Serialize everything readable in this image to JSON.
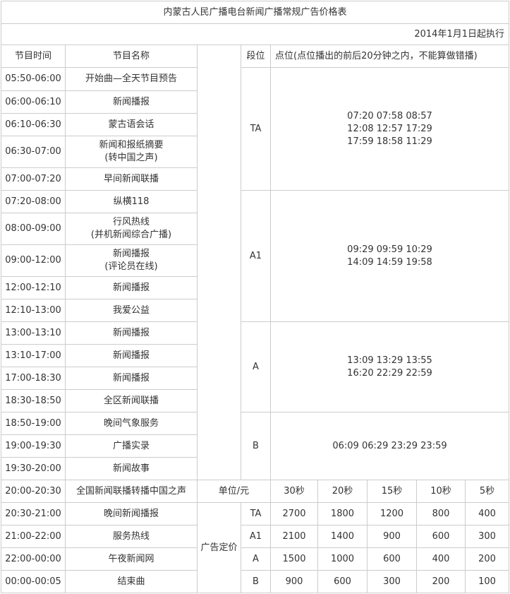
{
  "title": "内蒙古人民广播电台新闻广播常规广告价格表",
  "effective_date": "2014年1月1日起执行",
  "headers": {
    "time": "节目时间",
    "name": "节目名称",
    "segment": "段位",
    "slot": "点位(点位播出的前后20分钟之内，不能算做错播)"
  },
  "programs": [
    {
      "time": "05:50-06:00",
      "name": "开始曲—全天节目预告"
    },
    {
      "time": "06:00-06:10",
      "name": "新闻播报"
    },
    {
      "time": "06:10-06:30",
      "name": "蒙古语会话"
    },
    {
      "time": "06:30-07:00",
      "name": "新闻和报纸摘要",
      "sub": "(转中国之声)"
    },
    {
      "time": "07:00-07:20",
      "name": "早间新闻联播"
    },
    {
      "time": "07:20-08:00",
      "name": "纵横118"
    },
    {
      "time": "08:00-09:00",
      "name": "行风热线",
      "sub": "(并机新闻综合广播)"
    },
    {
      "time": "09:00-12:00",
      "name": "新闻播报",
      "sub": "(评论员在线)"
    },
    {
      "time": "12:00-12:10",
      "name": "新闻播报"
    },
    {
      "time": "12:10-13:00",
      "name": "我爱公益"
    },
    {
      "time": "13:00-13:10",
      "name": "新闻播报"
    },
    {
      "time": "13:10-17:00",
      "name": "新闻播报"
    },
    {
      "time": "17:00-18:30",
      "name": "新闻播报"
    },
    {
      "time": "18:30-18:50",
      "name": "全区新闻联播"
    },
    {
      "time": "18:50-19:00",
      "name": "晚间气象服务"
    },
    {
      "time": "19:00-19:30",
      "name": "广播实录"
    },
    {
      "time": "19:30-20:00",
      "name": "新闻故事"
    },
    {
      "time": "20:00-20:30",
      "name": "全国新闻联播转播中国之声"
    },
    {
      "time": "20:30-21:00",
      "name": "晚间新闻播报"
    },
    {
      "time": "21:00-22:00",
      "name": "服务热线"
    },
    {
      "time": "22:00-00:00",
      "name": "午夜新闻网"
    },
    {
      "time": "00:00-00:05",
      "name": "结束曲"
    }
  ],
  "segments": [
    {
      "label": "TA",
      "slots": [
        "07:20 07:58 08:57",
        "12:08 12:57 17:29",
        "17:59 18:58 11:29"
      ]
    },
    {
      "label": "A1",
      "slots": [
        "09:29 09:59 10:29",
        "14:09 14:59 19:58"
      ]
    },
    {
      "label": "A",
      "slots": [
        "13:09 13:29 13:55",
        "16:20 22:29 22:59"
      ]
    },
    {
      "label": "B",
      "slots": [
        "06:09 06:29 23:29 23:59"
      ]
    }
  ],
  "pricing": {
    "unit_label": "单位/元",
    "durations": [
      "30秒",
      "20秒",
      "15秒",
      "10秒",
      "5秒"
    ],
    "group_label": "广告定价",
    "rows": [
      {
        "segment": "TA",
        "prices": [
          "2700",
          "1800",
          "1200",
          "800",
          "400"
        ]
      },
      {
        "segment": "A1",
        "prices": [
          "2100",
          "1400",
          "900",
          "600",
          "300"
        ]
      },
      {
        "segment": "A",
        "prices": [
          "1500",
          "1000",
          "600",
          "400",
          "200"
        ]
      },
      {
        "segment": "B",
        "prices": [
          "900",
          "600",
          "300",
          "200",
          "100"
        ]
      }
    ]
  },
  "colors": {
    "border": "#cccccc",
    "text": "#333333",
    "background": "#ffffff"
  }
}
